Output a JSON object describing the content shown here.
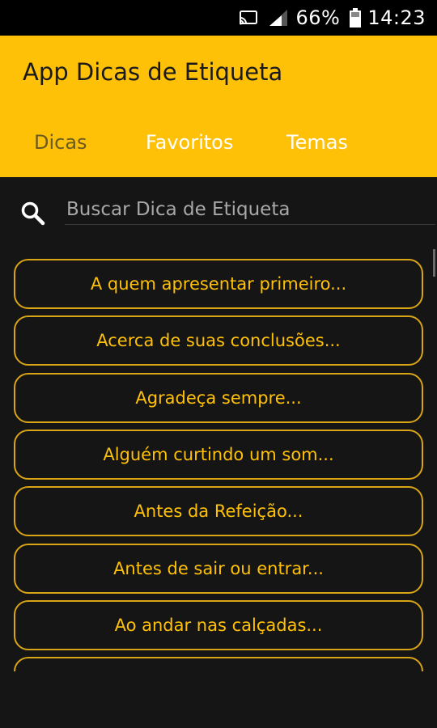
{
  "status_bar": {
    "battery": "66%",
    "time": "14:23",
    "icons": [
      "cast-icon",
      "signal-icon",
      "battery-icon"
    ]
  },
  "app": {
    "title": "App Dicas de Etiqueta",
    "accent_color": "#FFC107"
  },
  "tabs": [
    {
      "label": "Dicas",
      "active": true
    },
    {
      "label": "Favoritos",
      "active": false
    },
    {
      "label": "Temas",
      "active": false
    }
  ],
  "search": {
    "placeholder": "Buscar Dica de Etiqueta",
    "icon": "search-icon"
  },
  "tips": [
    "A quem apresentar primeiro...",
    "Acerca de suas conclusões...",
    "Agradeça sempre...",
    "Alguém curtindo um som...",
    "Antes da Refeição...",
    "Antes de sair ou entrar...",
    "Ao andar nas calçadas..."
  ]
}
